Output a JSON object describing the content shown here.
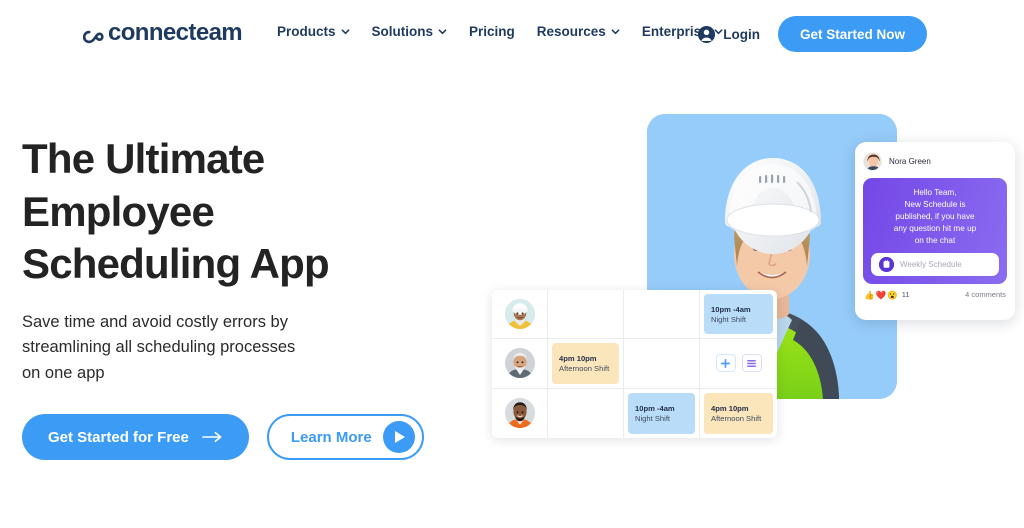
{
  "header": {
    "logo_text": "connecteam",
    "nav": [
      {
        "label": "Products",
        "has_chevron": true
      },
      {
        "label": "Solutions",
        "has_chevron": true
      },
      {
        "label": "Pricing",
        "has_chevron": false
      },
      {
        "label": "Resources",
        "has_chevron": true
      },
      {
        "label": "Enterprise",
        "has_chevron": true
      }
    ],
    "login_label": "Login",
    "cta_label": "Get Started Now"
  },
  "hero": {
    "headline": "The Ultimate\nEmployee\nScheduling App",
    "subhead": "Save time and avoid costly errors by\nstreamlining all scheduling processes\non one app",
    "primary_cta": "Get Started for Free",
    "secondary_cta": "Learn More"
  },
  "chat": {
    "author": "Nora Green",
    "message": "Hello Team,\nNew Schedule is\npublished, if you have\nany question hit me up\non the chat",
    "attachment_label": "Weekly Schedule",
    "reactions": [
      "👍",
      "❤️",
      "😮"
    ],
    "reaction_count": "11",
    "comments_label": "4 comments"
  },
  "schedule": {
    "rows": [
      {
        "cells": [
          {
            "type": "empty"
          },
          {
            "type": "empty"
          },
          {
            "type": "shift",
            "variant": "night",
            "time": "10pm -4am",
            "name": "Night Shift"
          }
        ]
      },
      {
        "cells": [
          {
            "type": "shift",
            "variant": "afternoon",
            "time": "4pm 10pm",
            "name": "Afternoon Shift"
          },
          {
            "type": "empty"
          },
          {
            "type": "buttons",
            "add_label": "+",
            "menu_label": "list"
          }
        ]
      },
      {
        "cells": [
          {
            "type": "empty"
          },
          {
            "type": "shift",
            "variant": "night",
            "time": "10pm -4am",
            "name": "Night Shift"
          },
          {
            "type": "shift",
            "variant": "afternoon",
            "time": "4pm 10pm",
            "name": "Afternoon Shift"
          }
        ]
      }
    ]
  },
  "colors": {
    "brand_blue": "#3b9bf5",
    "navy": "#1e3a5f",
    "photo_bg": "#96ccf9",
    "bubble_from": "#7447e6",
    "bubble_to": "#8a6cf1",
    "chip_night": "#b9dcf8",
    "chip_afternoon": "#fbe6bc"
  }
}
